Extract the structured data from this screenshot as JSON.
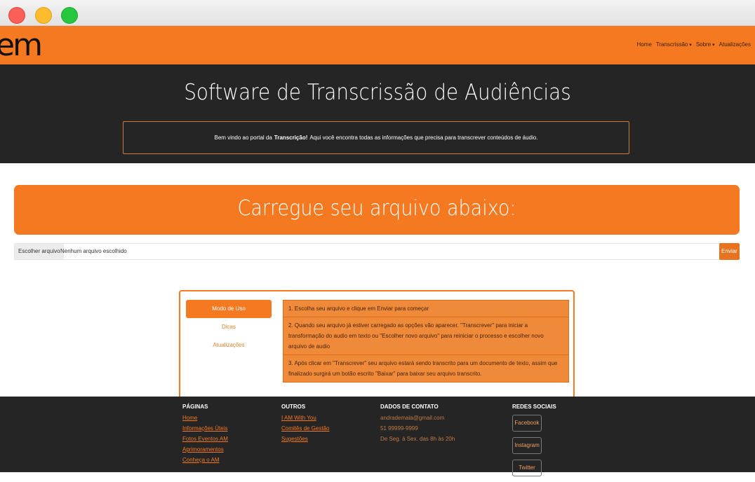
{
  "navbar": {
    "logo": "em",
    "links": [
      {
        "label": "Home",
        "dropdown": false
      },
      {
        "label": "Transcrissão",
        "dropdown": true
      },
      {
        "label": "Sobre",
        "dropdown": true
      },
      {
        "label": "Atualizações",
        "dropdown": false
      }
    ]
  },
  "hero": {
    "title": "Software de Transcrissão de Audiências",
    "welcome_prefix": "Bem vindo ao portal da",
    "welcome_bold": "Transcrição!",
    "welcome_suffix": "Aqui você encontra todas as informações que precisa para transcrever conteúdos de áudio."
  },
  "upload": {
    "title": "Carregue seu arquivo abaixo:",
    "choose_label": "Escolher arquivo",
    "status": "Nenhum arquivo escolhido",
    "send_label": "Enviar"
  },
  "instructions": {
    "tabs": [
      {
        "label": "Modo de Uso",
        "active": true
      },
      {
        "label": "Dicas",
        "active": false
      },
      {
        "label": "Atualizações",
        "active": false
      }
    ],
    "steps": [
      "1. Escolha seu arquivo e clique em Enviar para começar",
      "2. Quando seu arquivo já estiver carregado as opções vão aparecer. \"Transcrever\" para iniciar a transformação do audio em texto ou \"Escolher novo arquivo\" para reiniciar o processo e escolher novo arquivo de audio",
      "3. Após clicar em \"Transcrever\" seu arquivo estará sendo transcrito para um documento de texto, assim que finalizado surgirá um botão escrito \"Baixar\" para baixar seu arquivo transcrito."
    ]
  },
  "footer": {
    "pages": {
      "heading": "PÁGINAS",
      "links": [
        "Home",
        "Informações Úteis",
        "Fotos Eventos AM",
        "Aprimoramentos",
        "Conheça o AM"
      ]
    },
    "others": {
      "heading": "OUTROS",
      "links": [
        "I AM With You",
        "Comitês de Gestão",
        "Sugestões"
      ]
    },
    "contact": {
      "heading": "DADOS DE CONTATO",
      "lines": [
        "andrademaia@gmail.com",
        "51 99999-9999",
        "De Seg. à Sex. das 8h às 20h"
      ]
    },
    "social": {
      "heading": "REDES SOCIAIS",
      "buttons": [
        "Facebook",
        "Instagram",
        "Twitter"
      ]
    }
  },
  "colors": {
    "brand_orange": "#f47920",
    "dark_bg": "#252525"
  }
}
